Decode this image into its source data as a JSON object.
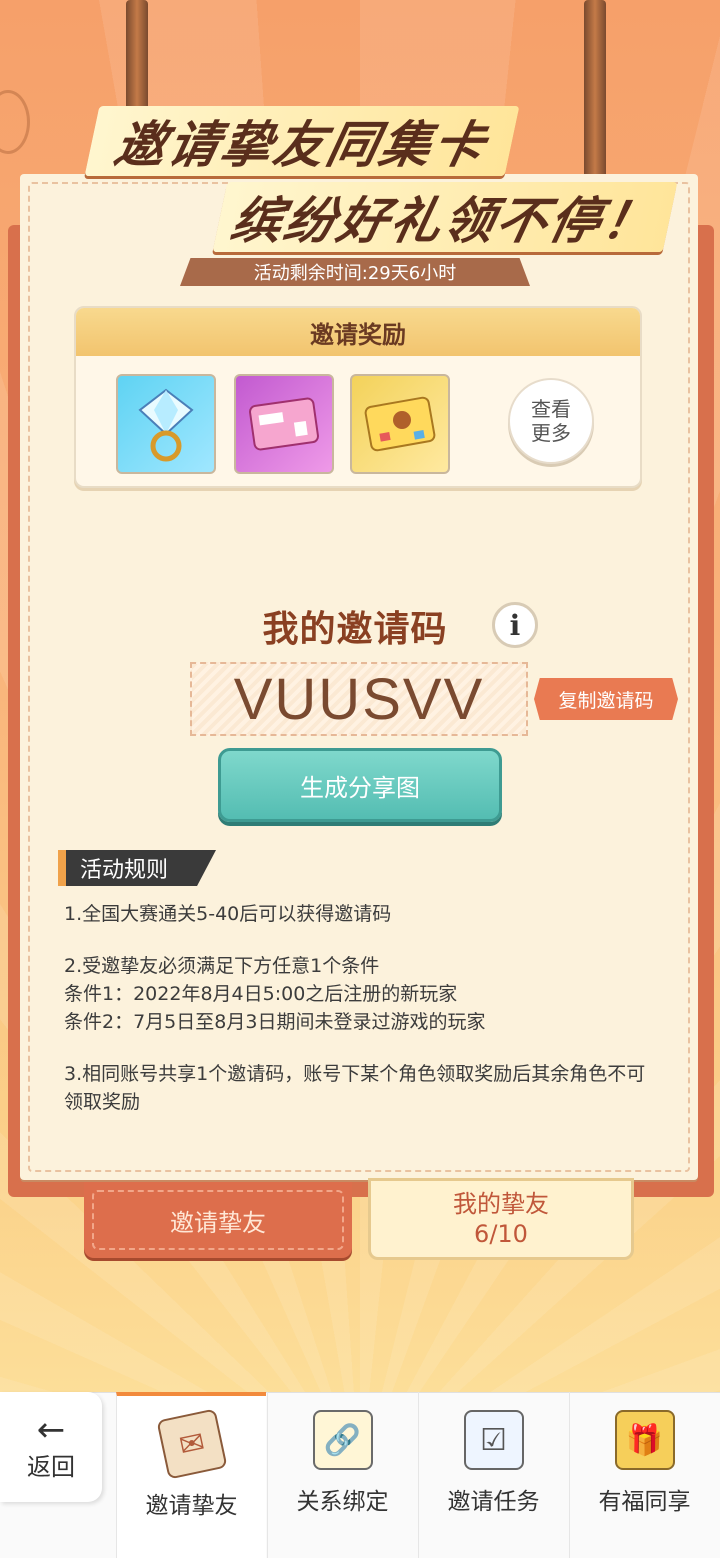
{
  "banner": {
    "line1": "邀请挚友同集卡",
    "line2": "缤纷好礼领不停！",
    "timer": "活动剩余时间:29天6小时"
  },
  "rewards": {
    "title": "邀请奖励",
    "items": [
      {
        "icon": "diamond-ring-icon"
      },
      {
        "icon": "pink-ticket-icon"
      },
      {
        "icon": "gold-card-icon"
      }
    ],
    "view_more": "查看\n更多"
  },
  "invite_code": {
    "title": "我的邀请码",
    "info_icon": "i",
    "code": "VUUSVV",
    "copy_label": "复制邀请码",
    "share_label": "生成分享图"
  },
  "rules": {
    "header": "活动规则",
    "items": [
      "1.全国大赛通关5-40后可以获得邀请码",
      "2.受邀挚友必须满足下方任意1个条件\n   条件1：2022年8月4日5:00之后注册的新玩家\n   条件2：7月5日至8月3日期间未登录过游戏的玩家",
      "3.相同账号共享1个邀请码，账号下某个角色领取奖励后其余角色不可领取奖励"
    ]
  },
  "tabs": {
    "invite": "邀请挚友",
    "friends_label": "我的挚友",
    "friends_count": "6/10"
  },
  "bottom_nav": {
    "back": "返回",
    "back_arrow": "←",
    "items": [
      {
        "label": "邀请挚友",
        "icon": "invitation-letter-icon"
      },
      {
        "label": "关系绑定",
        "icon": "id-card-link-icon"
      },
      {
        "label": "邀请任务",
        "icon": "clipboard-checklist-icon"
      },
      {
        "label": "有福同享",
        "icon": "gift-box-icon"
      }
    ]
  },
  "colors": {
    "accent": "#f28a3c",
    "card_bg": "#fcf2dc",
    "share_button": "#54bdb2",
    "invite_tab": "#dd6e4c"
  }
}
